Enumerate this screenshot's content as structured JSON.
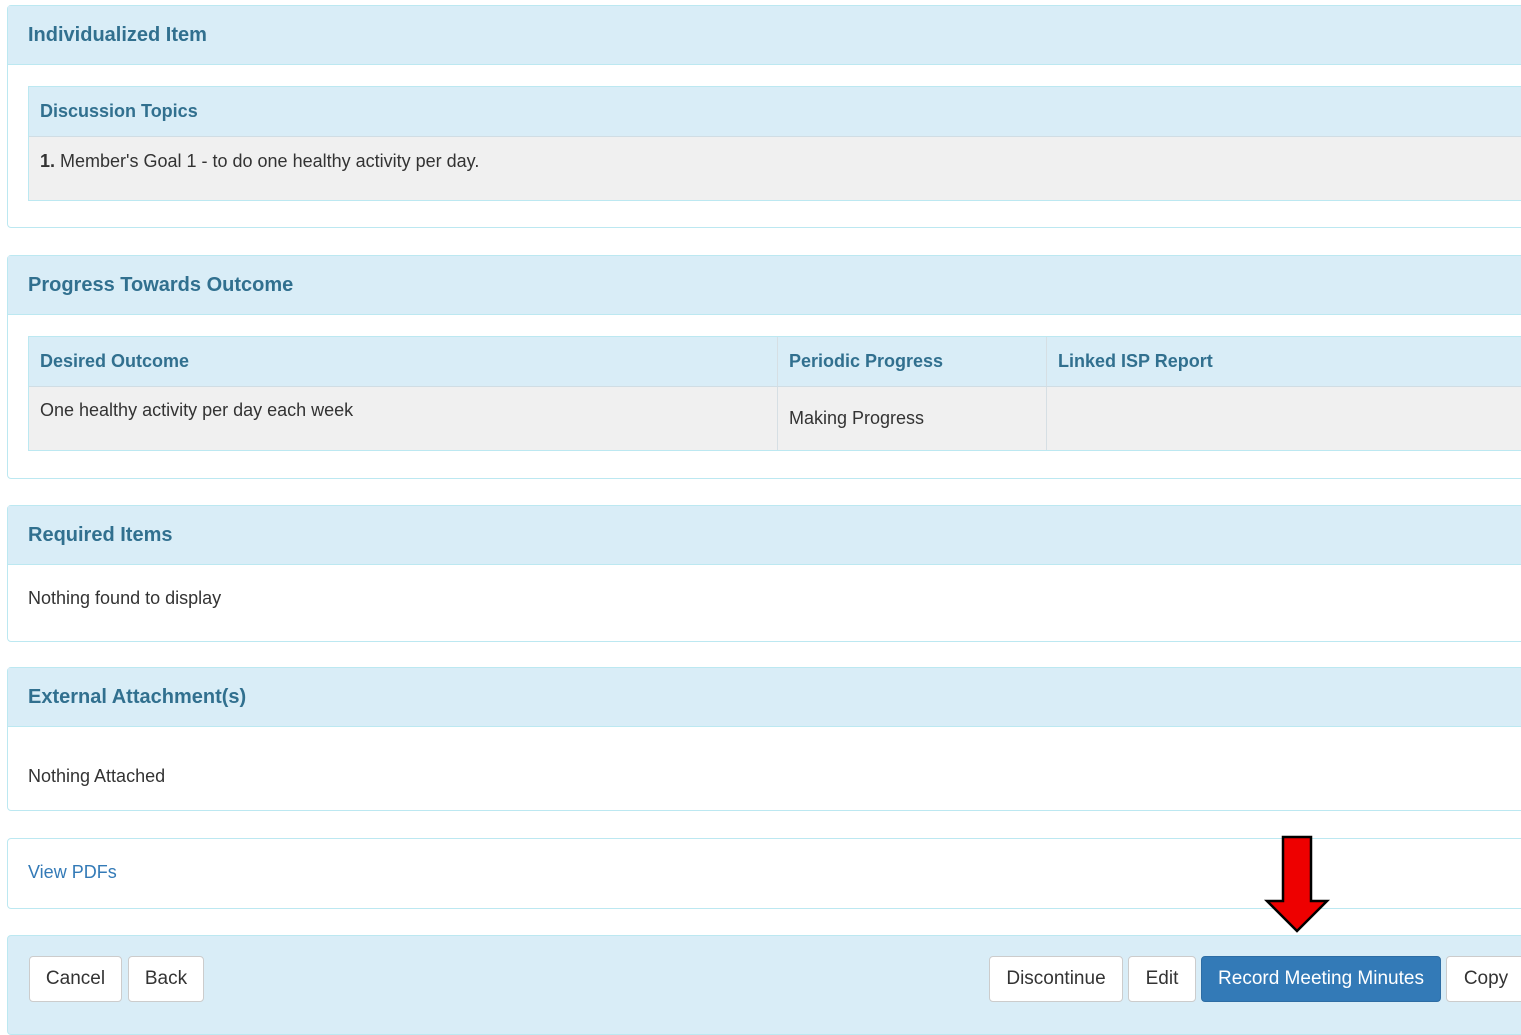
{
  "individualized_item": {
    "heading": "Individualized Item",
    "discussion_topics": {
      "header": "Discussion Topics",
      "items": [
        {
          "number": "1.",
          "text": "Member's Goal 1 - to do one healthy activity per day."
        }
      ]
    }
  },
  "progress": {
    "heading": "Progress Towards Outcome",
    "columns": [
      "Desired Outcome",
      "Periodic Progress",
      "Linked ISP Report"
    ],
    "rows": [
      [
        "One healthy activity per day each week",
        "Making Progress",
        ""
      ]
    ]
  },
  "required_items": {
    "heading": "Required Items",
    "empty_text": "Nothing found to display"
  },
  "external_attachments": {
    "heading": "External Attachment(s)",
    "empty_text": "Nothing Attached"
  },
  "view_pdfs": {
    "link_text": "View PDFs"
  },
  "footer": {
    "cancel_label": "Cancel",
    "back_label": "Back",
    "discontinue_label": "Discontinue",
    "edit_label": "Edit",
    "record_label": "Record Meeting Minutes",
    "copy_label": "Copy"
  },
  "annotation": {
    "arrow_color": "#ee0000",
    "arrow_icon": "red-down-arrow-icon"
  },
  "colors": {
    "panel_heading_bg": "#d9edf7",
    "panel_heading_text": "#31708f",
    "panel_border": "#bce8f1",
    "primary": "#337ab7"
  }
}
